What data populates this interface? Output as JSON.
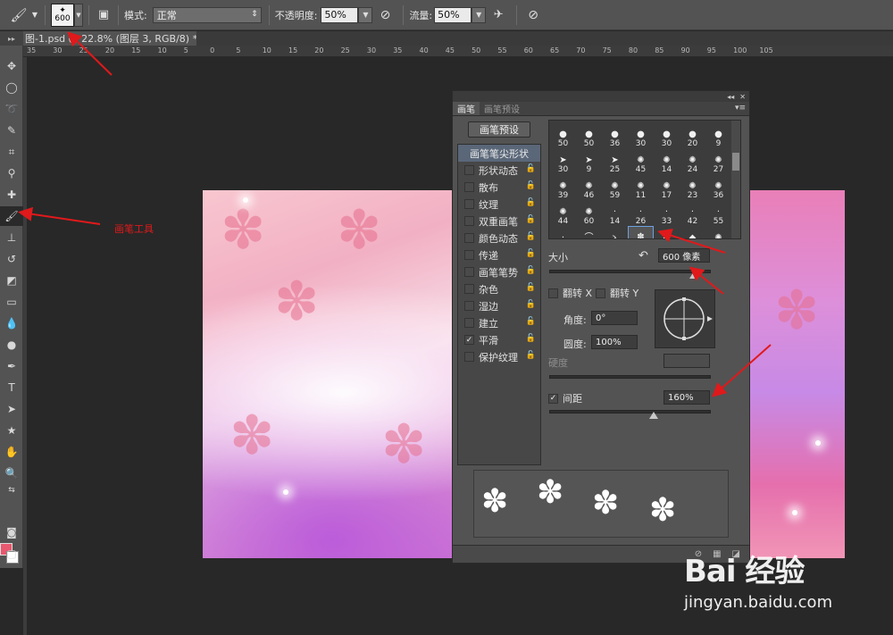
{
  "options_bar": {
    "brush_size": "600",
    "mode_label": "模式:",
    "mode_value": "正常",
    "opacity_label": "不透明度:",
    "opacity_value": "50%",
    "flow_label": "流量:",
    "flow_value": "50%"
  },
  "doc_tab": {
    "title": "图-1.psd @ 22.8% (图层 3, RGB/8) *",
    "close": "×"
  },
  "ruler_marks": [
    "35",
    "30",
    "25",
    "20",
    "15",
    "10",
    "5",
    "0",
    "5",
    "10",
    "15",
    "20",
    "25",
    "30",
    "35",
    "40",
    "45",
    "50",
    "55",
    "60",
    "65",
    "70",
    "75",
    "80",
    "85",
    "90",
    "95",
    "100",
    "105"
  ],
  "panel": {
    "tab_brush": "画笔",
    "tab_presets": "画笔预设",
    "preset_button": "画笔预设",
    "options_header": "画笔笔尖形状",
    "options": [
      {
        "label": "形状动态",
        "checked": false
      },
      {
        "label": "散布",
        "checked": false
      },
      {
        "label": "纹理",
        "checked": false
      },
      {
        "label": "双重画笔",
        "checked": false
      },
      {
        "label": "颜色动态",
        "checked": false
      },
      {
        "label": "传递",
        "checked": false
      },
      {
        "label": "画笔笔势",
        "checked": false
      },
      {
        "label": "杂色",
        "checked": false
      },
      {
        "label": "湿边",
        "checked": false
      },
      {
        "label": "建立",
        "checked": false
      },
      {
        "label": "平滑",
        "checked": true
      },
      {
        "label": "保护纹理",
        "checked": false
      }
    ],
    "brush_sizes": [
      "50",
      "50",
      "36",
      "30",
      "30",
      "20",
      "9",
      "30",
      "9",
      "25",
      "45",
      "14",
      "24",
      "27",
      "39",
      "46",
      "59",
      "11",
      "17",
      "23",
      "36",
      "44",
      "60",
      "14",
      "26",
      "33",
      "42",
      "55",
      "70",
      "112",
      "134",
      "74",
      "95",
      "95",
      "90"
    ],
    "size_label": "大小",
    "size_value": "600 像素",
    "flip_x": "翻转 X",
    "flip_y": "翻转 Y",
    "angle_label": "角度:",
    "angle_value": "0°",
    "roundness_label": "圆度:",
    "roundness_value": "100%",
    "hardness_label": "硬度",
    "spacing_label": "间距",
    "spacing_value": "160%",
    "spacing_checked": true
  },
  "annotation": {
    "brush_tool": "画笔工具"
  },
  "watermark": {
    "logo": "Bai 经验",
    "url": "jingyan.baidu.com"
  },
  "colors": {
    "foreground": "#e8586f",
    "background": "#ffffff",
    "annotation": "#e0191b"
  }
}
